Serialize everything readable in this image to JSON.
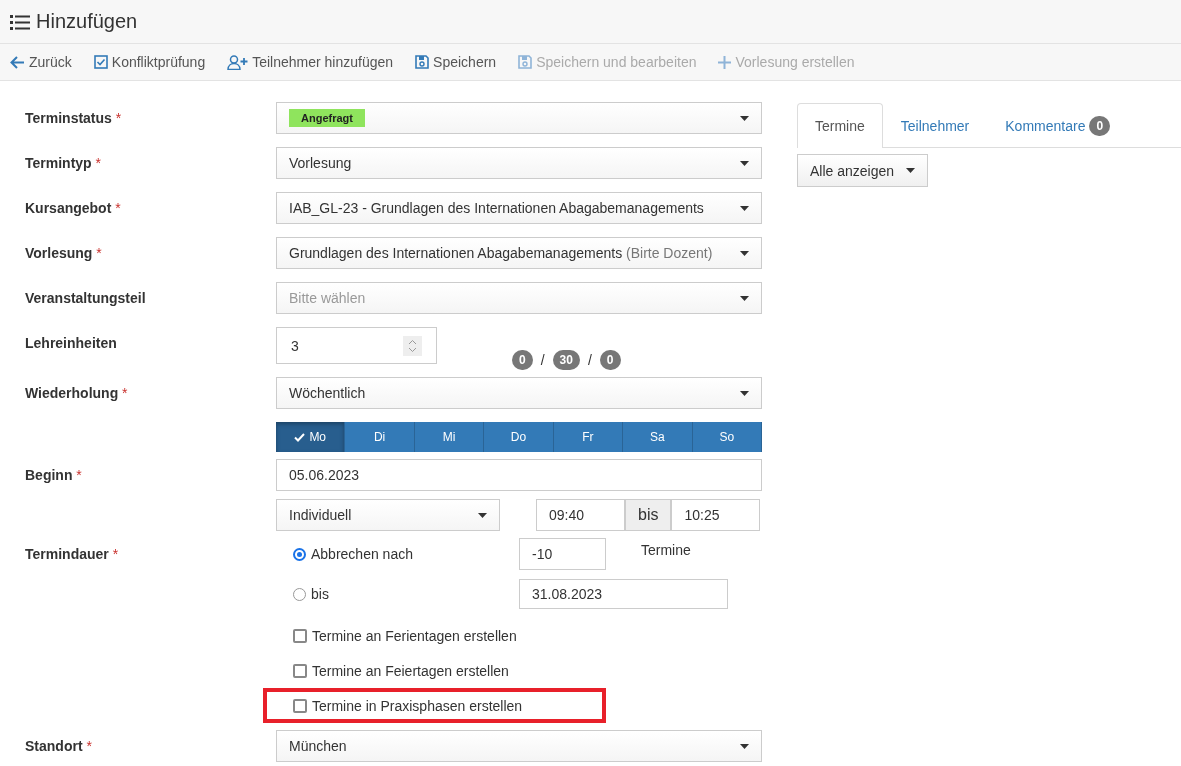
{
  "header": {
    "title": "Hinzufügen"
  },
  "toolbar": [
    {
      "kind": "back",
      "label": "Zurück",
      "disabled": false
    },
    {
      "kind": "check",
      "label": "Konfliktprüfung",
      "disabled": false
    },
    {
      "kind": "user_add",
      "label": "Teilnehmer hinzufügen",
      "disabled": false
    },
    {
      "kind": "save",
      "label": "Speichern",
      "disabled": false
    },
    {
      "kind": "save",
      "label": "Speichern und bearbeiten",
      "disabled": true
    },
    {
      "kind": "plus",
      "label": "Vorlesung erstellen",
      "disabled": true
    }
  ],
  "form": [
    {
      "kind": "tag_select",
      "label": "Terminstatus",
      "mark": "*",
      "value": "Angefragt"
    },
    {
      "kind": "select",
      "label": "Termintyp",
      "mark": "*",
      "value": "Vorlesung"
    },
    {
      "kind": "select",
      "label": "Kursangebot",
      "mark": "*",
      "value": "IAB_GL-23 - Grundlagen des Internationen Abagabemanagements"
    },
    {
      "kind": "select",
      "label": "Vorlesung",
      "mark": "*",
      "value": "Grundlagen des Internationen Abagabemanagements",
      "note": "(Birte Dozent)"
    },
    {
      "kind": "select",
      "label": "Veranstaltungsteil",
      "placeholder": "Bitte wählen"
    },
    {
      "kind": "number",
      "label": "Lehreinheiten",
      "value": "3",
      "counters": [
        "0",
        "30",
        "0"
      ],
      "separator": "/"
    },
    {
      "kind": "repeat",
      "label": "Wiederholung",
      "mark": "*",
      "value": "Wöchentlich",
      "weekdays": [
        {
          "label": "Mo",
          "selected": true
        },
        {
          "label": "Di",
          "selected": false
        },
        {
          "label": "Mi",
          "selected": false
        },
        {
          "label": "Do",
          "selected": false
        },
        {
          "label": "Fr",
          "selected": false
        },
        {
          "label": "Sa",
          "selected": false
        },
        {
          "label": "So",
          "selected": false
        }
      ]
    },
    {
      "kind": "date",
      "label": "Beginn",
      "mark": "*",
      "value": "05.06.2023"
    },
    {
      "kind": "time",
      "mode": "Individuell",
      "start": "09:40",
      "separator": "bis",
      "end": "10:25"
    },
    {
      "kind": "duration",
      "label": "Termindauer",
      "mark": "*",
      "options": [
        {
          "label": "Abbrechen nach",
          "selected": true,
          "value": "-10",
          "suffix": "Termine"
        },
        {
          "label": "bis",
          "selected": false,
          "value": "31.08.2023"
        }
      ],
      "checkboxes": [
        {
          "label": "Termine an Ferientagen erstellen",
          "checked": false,
          "highlighted": false
        },
        {
          "label": "Termine an Feiertagen erstellen",
          "checked": false,
          "highlighted": false
        },
        {
          "label": "Termine in Praxisphasen erstellen",
          "checked": false,
          "highlighted": true
        }
      ]
    },
    {
      "kind": "select",
      "label": "Standort",
      "mark": "*",
      "value": "München"
    }
  ],
  "side": {
    "tabs": [
      {
        "label": "Termine",
        "selected": true
      },
      {
        "label": "Teilnehmer",
        "selected": false
      },
      {
        "label": "Kommentare",
        "selected": false,
        "badge": "0"
      }
    ],
    "filter": "Alle anzeigen"
  }
}
